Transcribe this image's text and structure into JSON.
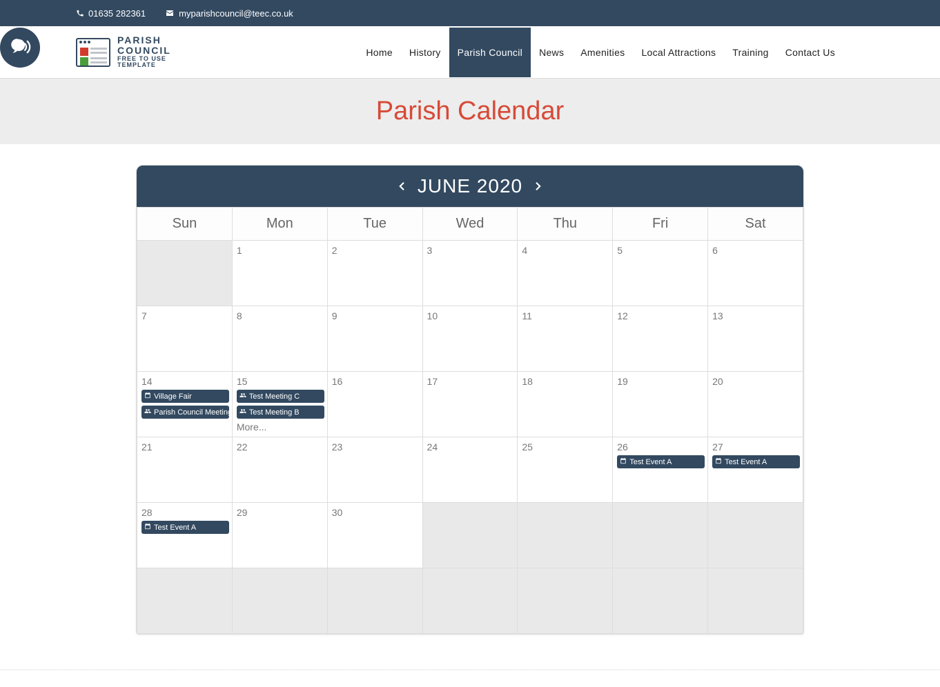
{
  "topbar": {
    "phone": "01635 282361",
    "email": "myparishcouncil@teec.co.uk"
  },
  "logo": {
    "line1": "PARISH",
    "line2": "COUNCIL",
    "line3": "FREE TO USE",
    "line4": "TEMPLATE"
  },
  "nav": {
    "items": [
      {
        "label": "Home"
      },
      {
        "label": "History"
      },
      {
        "label": "Parish Council",
        "active": true
      },
      {
        "label": "News"
      },
      {
        "label": "Amenities"
      },
      {
        "label": "Local Attractions"
      },
      {
        "label": "Training"
      },
      {
        "label": "Contact Us"
      }
    ]
  },
  "hero": {
    "title": "Parish Calendar"
  },
  "calendar": {
    "month_label": "JUNE 2020",
    "weekdays": [
      "Sun",
      "Mon",
      "Tue",
      "Wed",
      "Thu",
      "Fri",
      "Sat"
    ],
    "more_label": "More...",
    "weeks": [
      [
        {
          "pad": true
        },
        {
          "day": "1"
        },
        {
          "day": "2"
        },
        {
          "day": "3"
        },
        {
          "day": "4"
        },
        {
          "day": "5"
        },
        {
          "day": "6"
        }
      ],
      [
        {
          "day": "7"
        },
        {
          "day": "8"
        },
        {
          "day": "9"
        },
        {
          "day": "10"
        },
        {
          "day": "11"
        },
        {
          "day": "12"
        },
        {
          "day": "13"
        }
      ],
      [
        {
          "day": "14",
          "events": [
            {
              "icon": "calendar",
              "label": "Village Fair"
            },
            {
              "icon": "group",
              "label": "Parish Council Meeting"
            }
          ]
        },
        {
          "day": "15",
          "events": [
            {
              "icon": "group",
              "label": "Test Meeting C"
            },
            {
              "icon": "group",
              "label": "Test Meeting B"
            }
          ],
          "more": true
        },
        {
          "day": "16"
        },
        {
          "day": "17"
        },
        {
          "day": "18"
        },
        {
          "day": "19"
        },
        {
          "day": "20"
        }
      ],
      [
        {
          "day": "21"
        },
        {
          "day": "22"
        },
        {
          "day": "23"
        },
        {
          "day": "24"
        },
        {
          "day": "25"
        },
        {
          "day": "26",
          "events": [
            {
              "icon": "calendar",
              "label": "Test Event A"
            }
          ]
        },
        {
          "day": "27",
          "events": [
            {
              "icon": "calendar",
              "label": "Test Event A"
            }
          ]
        }
      ],
      [
        {
          "day": "28",
          "events": [
            {
              "icon": "calendar",
              "label": "Test Event A"
            }
          ]
        },
        {
          "day": "29"
        },
        {
          "day": "30"
        },
        {
          "pad": true
        },
        {
          "pad": true
        },
        {
          "pad": true
        },
        {
          "pad": true
        }
      ],
      [
        {
          "pad": true
        },
        {
          "pad": true
        },
        {
          "pad": true
        },
        {
          "pad": true
        },
        {
          "pad": true
        },
        {
          "pad": true
        },
        {
          "pad": true
        }
      ]
    ]
  }
}
